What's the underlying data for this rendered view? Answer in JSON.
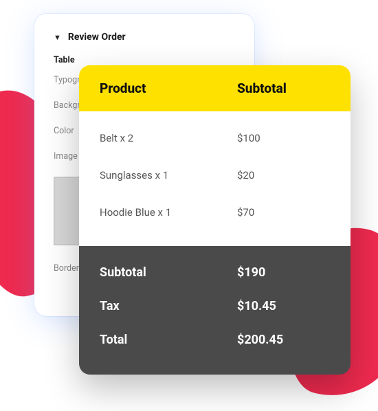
{
  "settings": {
    "section_title": "Review Order",
    "subhead": "Table",
    "fields": {
      "typography": "Typography",
      "background": "Background",
      "color": "Color",
      "image": "Image",
      "border_type": "Border Type"
    }
  },
  "order": {
    "header": {
      "product": "Product",
      "subtotal": "Subtotal"
    },
    "items": [
      {
        "name": "Belt x 2",
        "price": "$100"
      },
      {
        "name": "Sunglasses x 1",
        "price": "$20"
      },
      {
        "name": "Hoodie Blue x 1",
        "price": "$70"
      }
    ],
    "totals": {
      "subtotal_label": "Subtotal",
      "subtotal_value": "$190",
      "tax_label": "Tax",
      "tax_value": "$10.45",
      "total_label": "Total",
      "total_value": "$200.45"
    }
  }
}
